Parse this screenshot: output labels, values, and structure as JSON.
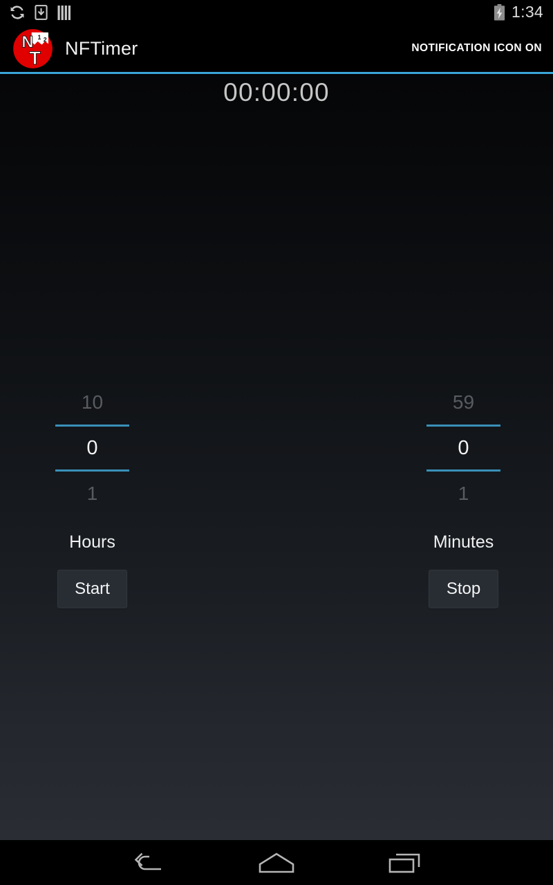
{
  "status_bar": {
    "icons": [
      "sync-icon",
      "download-to-device-icon",
      "vertical-bars-icon"
    ],
    "battery_icon": "battery-charging-icon",
    "clock": "1:34"
  },
  "action_bar": {
    "logo_icon": "nftimer-logo-icon",
    "title": "NFTimer",
    "action_label": "NOTIFICATION ICON ON",
    "accent_color": "#3aa6d8"
  },
  "main": {
    "timer_display": "00:00:00",
    "pickers": [
      {
        "name": "hours",
        "label": "Hours",
        "value_above": "10",
        "value": "0",
        "value_below": "1",
        "button_label": "Start",
        "button_name": "start-button"
      },
      {
        "name": "minutes",
        "label": "Minutes",
        "value_above": "59",
        "value": "0",
        "value_below": "1",
        "button_label": "Stop",
        "button_name": "stop-button"
      }
    ]
  },
  "nav_bar": {
    "back_icon": "back-arrow-icon",
    "home_icon": "home-icon",
    "recents_icon": "recent-apps-icon"
  }
}
